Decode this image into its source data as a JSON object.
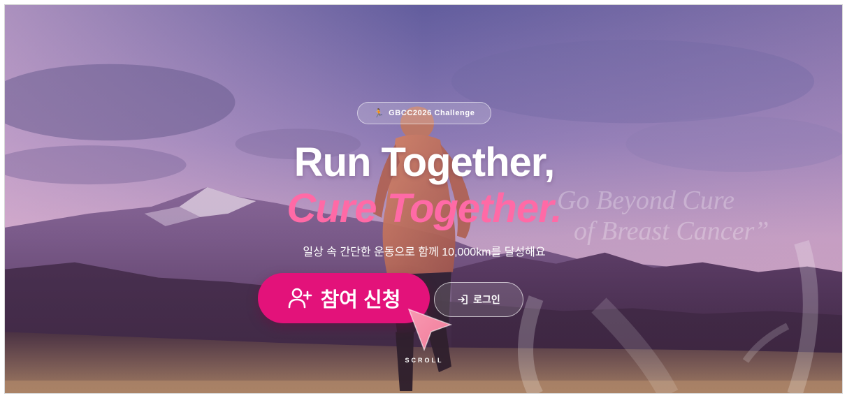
{
  "badge": {
    "icon": "runner-icon",
    "text": "GBCC2026 Challenge"
  },
  "hero": {
    "title_line1": "Run Together,",
    "title_line2": "Cure Together.",
    "subtitle": "일상 속 간단한 운동으로 함께 10,000km를 달성해요"
  },
  "quote": {
    "line1": "Go Beyond Cure",
    "line2": "of Breast Cancer”"
  },
  "buttons": {
    "join_label": "참여 신청",
    "join_icon": "user-plus-icon",
    "login_label": "로그인",
    "login_icon": "login-icon"
  },
  "scroll": {
    "label": "SCROLL"
  },
  "colors": {
    "accent": "#e3127a",
    "title_pink": "#ff6aa6"
  }
}
